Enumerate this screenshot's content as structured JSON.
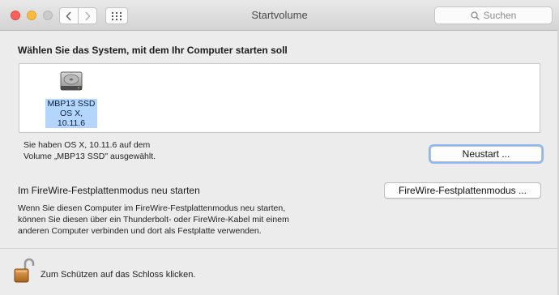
{
  "window": {
    "title": "Startvolume",
    "search_placeholder": "Suchen"
  },
  "nav": {
    "back_icon": "chevron-left-icon",
    "forward_icon": "chevron-right-icon",
    "grid_icon": "grid-icon"
  },
  "main": {
    "heading": "Wählen Sie das System, mit dem Ihr Computer starten soll",
    "disk": {
      "name": "MBP13 SSD",
      "os": "OS X, 10.11.6",
      "icon": "hard-drive-icon"
    },
    "selection_info_line1": "Sie haben OS X, 10.11.6 auf dem",
    "selection_info_line2": "Volume „MBP13 SSD\" ausgewählt.",
    "restart_label": "Neustart ...",
    "firewire": {
      "heading": "Im FireWire-Festplattenmodus neu starten",
      "button_label": "FireWire-Festplattenmodus ...",
      "desc_line1": "Wenn Sie diesen Computer im FireWire-Festplattenmodus neu starten,",
      "desc_line2": "können Sie diesen über ein Thunderbolt- oder FireWire-Kabel mit einem",
      "desc_line3": "anderen Computer verbinden und dort als Festplatte verwenden."
    }
  },
  "footer": {
    "lock_text": "Zum Schützen auf das Schloss klicken.",
    "lock_icon": "open-lock-icon"
  },
  "colors": {
    "close": "#fc605c",
    "minimize": "#fdbc40",
    "selection": "#b4d6fd",
    "focus_ring": "#8cb9f5"
  }
}
